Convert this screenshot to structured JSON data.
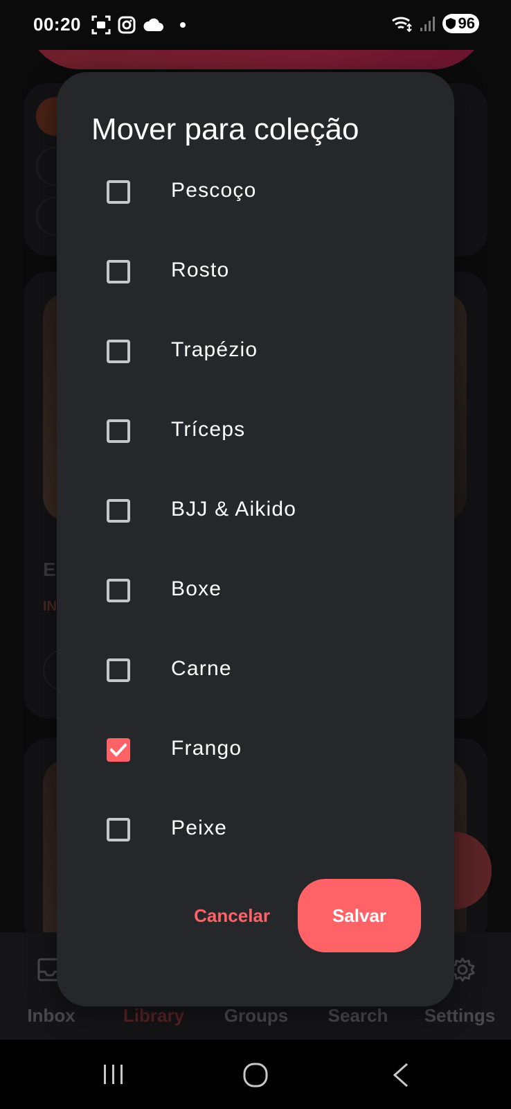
{
  "status_bar": {
    "time": "00:20",
    "battery": "96",
    "icons_left": [
      "screenshot-icon",
      "instagram-icon",
      "cloud-icon",
      "notification-dot"
    ],
    "icons_right": [
      "wifi-icon",
      "signal-icon",
      "battery-icon"
    ]
  },
  "bottom_nav": {
    "items": [
      {
        "label": "Inbox",
        "icon": "inbox-icon"
      },
      {
        "label": "Library",
        "icon": "library-icon"
      },
      {
        "label": "Groups",
        "icon": "groups-icon"
      },
      {
        "label": "Search",
        "icon": "search-icon"
      },
      {
        "label": "Settings",
        "icon": "gear-icon"
      }
    ],
    "active": "Library"
  },
  "dialog": {
    "title": "Mover para coleção",
    "options": [
      {
        "label": "Pescoço",
        "checked": false
      },
      {
        "label": "Rosto",
        "checked": false
      },
      {
        "label": "Trapézio",
        "checked": false
      },
      {
        "label": "Tríceps",
        "checked": false
      },
      {
        "label": "BJJ & Aikido",
        "checked": false
      },
      {
        "label": "Boxe",
        "checked": false
      },
      {
        "label": "Carne",
        "checked": false
      },
      {
        "label": "Frango",
        "checked": true
      },
      {
        "label": "Peixe",
        "checked": false
      }
    ],
    "cancel_label": "Cancelar",
    "save_label": "Salvar"
  },
  "colors": {
    "accent": "#ff6267",
    "dialog_bg": "#26272b",
    "page_bg": "#0b0b0c"
  }
}
